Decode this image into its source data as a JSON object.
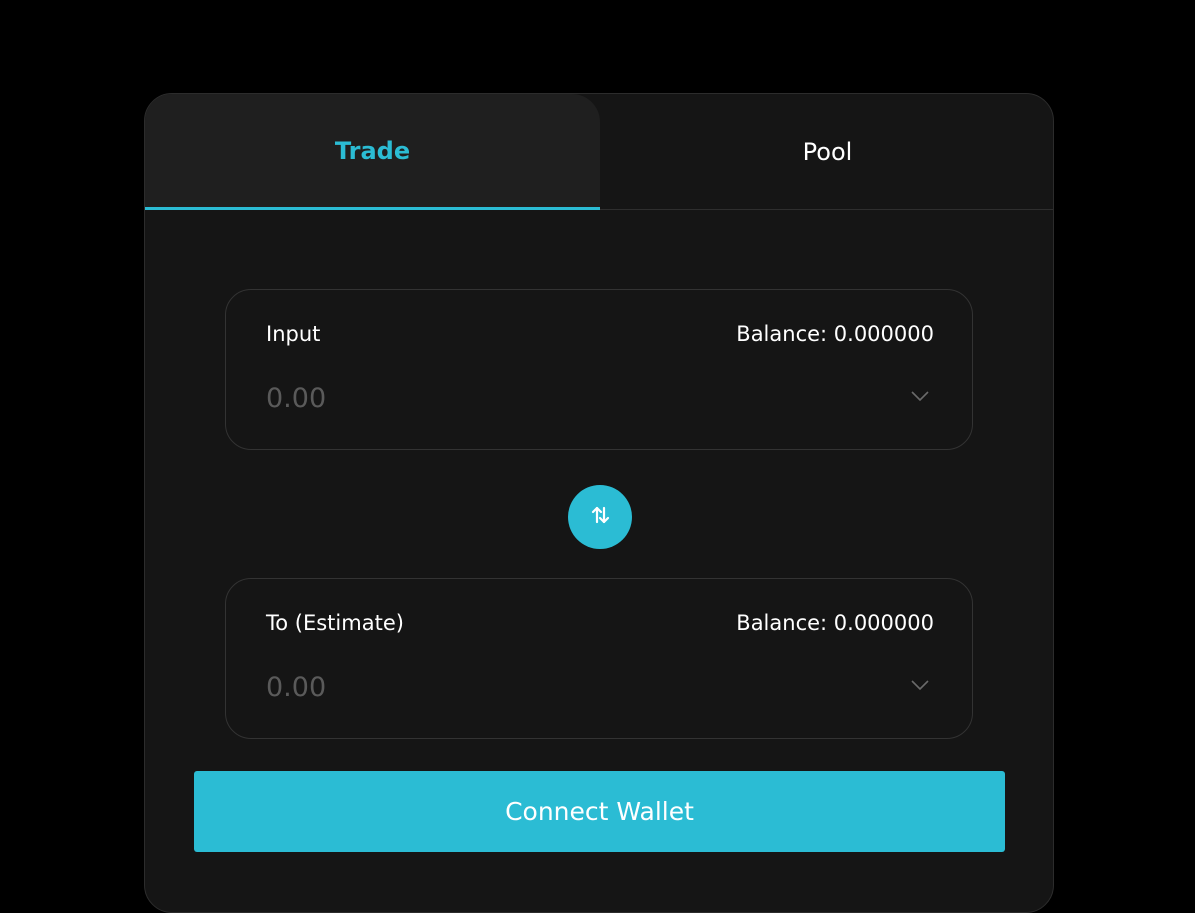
{
  "tabs": {
    "trade_label": "Trade",
    "pool_label": "Pool",
    "active": "Trade"
  },
  "input_box": {
    "label": "Input",
    "balance": "Balance: 0.000000",
    "placeholder": "0.00",
    "token_select_icon": "chevron-down-icon"
  },
  "swap_button": {
    "icon": "swap-arrows-icon"
  },
  "output_box": {
    "label": "To (Estimate)",
    "balance": "Balance: 0.000000",
    "placeholder": "0.00",
    "token_select_icon": "chevron-down-icon"
  },
  "connect_button": {
    "label": "Connect Wallet"
  },
  "colors": {
    "accent": "#2bbcd4",
    "background": "#000000",
    "card": "#151515",
    "active_tab": "#1f1f1f",
    "border": "#333333",
    "placeholder": "#5a5a5a",
    "text": "#ffffff"
  }
}
